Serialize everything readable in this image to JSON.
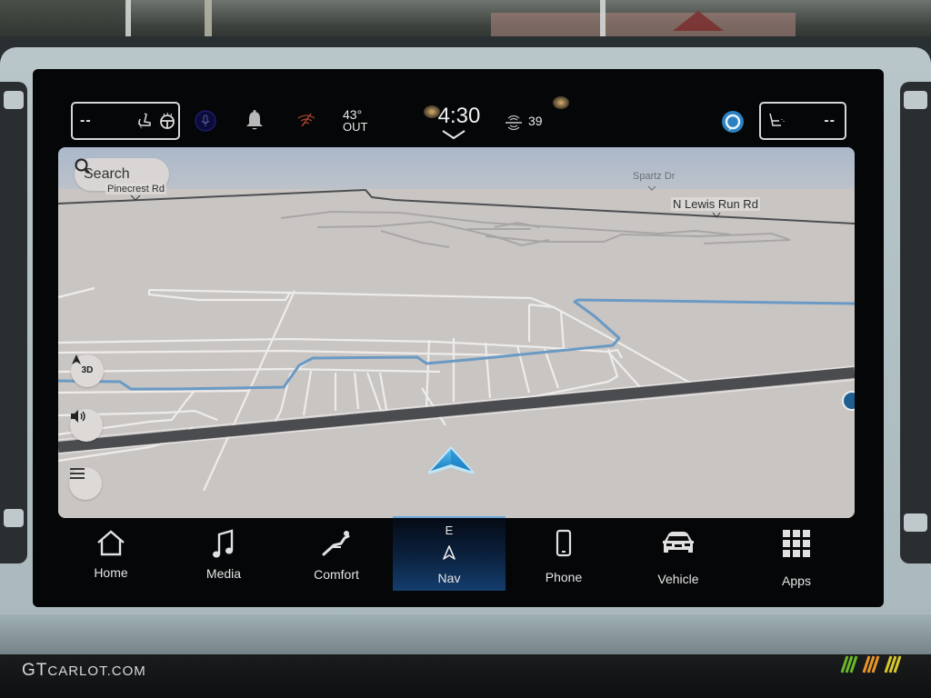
{
  "status_bar": {
    "driver_seat_value": "--",
    "passenger_seat_value": "--",
    "outside_temp": "43°",
    "outside_label": "OUT",
    "clock": "4:30",
    "radio_source_icon": "sirius-xm-icon",
    "radio_channel": "39",
    "icons": [
      "heated-seat-icon",
      "heated-steering-wheel-icon",
      "voice-assistant-icon",
      "notification-bell-icon",
      "no-signal-icon",
      "alexa-icon",
      "ventilated-seat-icon"
    ]
  },
  "map": {
    "search_label": "Search",
    "street_labels": {
      "top_left": "Pinecrest Rd",
      "spartz": "Spartz Dr",
      "lewis": "N Lewis Run Rd"
    },
    "buttons": {
      "view_mode": "3D",
      "volume": "volume-icon",
      "menu": "menu-icon"
    },
    "colors": {
      "background": "#c9c5c3",
      "route": "#6a9ac4",
      "vehicle_arrow": "#2a9ad8",
      "major_road": "#4a4c50"
    }
  },
  "nav_bar": {
    "items": [
      {
        "label": "Home",
        "icon": "home-icon"
      },
      {
        "label": "Media",
        "icon": "music-note-icon"
      },
      {
        "label": "Comfort",
        "icon": "seat-recline-icon"
      },
      {
        "label": "Nav",
        "icon": "navigation-arrow-icon",
        "active": true,
        "heading": "E"
      },
      {
        "label": "Phone",
        "icon": "phone-icon"
      },
      {
        "label": "Vehicle",
        "icon": "car-icon"
      },
      {
        "label": "Apps",
        "icon": "apps-grid-icon"
      }
    ]
  },
  "watermark": {
    "brand_big": "GT",
    "brand_small": "CARLOT.COM"
  }
}
